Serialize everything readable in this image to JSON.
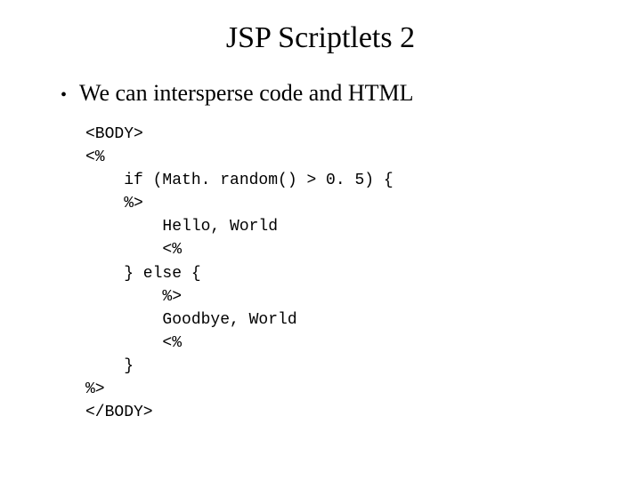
{
  "title": "JSP Scriptlets 2",
  "bullet": {
    "text": "We can intersperse code and HTML"
  },
  "code": {
    "l1": "<BODY>",
    "l2": "<%",
    "l3": "    if (Math. random() > 0. 5) {",
    "l4": "    %>",
    "l5": "        Hello, World",
    "l6": "        <%",
    "l7": "    } else {",
    "l8": "        %>",
    "l9": "        Goodbye, World",
    "l10": "        <%",
    "l11": "    }",
    "l12": "%>",
    "l13": "</BODY>"
  }
}
